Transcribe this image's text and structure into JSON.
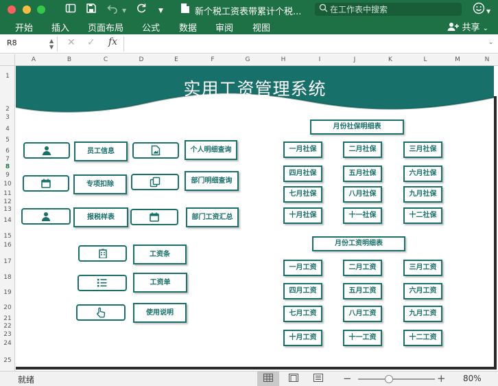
{
  "window": {
    "title": "新个税工资表带累计个税...",
    "search_placeholder": "在工作表中搜索"
  },
  "menu": {
    "items": [
      "开始",
      "插入",
      "页面布局",
      "公式",
      "数据",
      "审阅",
      "视图"
    ],
    "share_label": "共享"
  },
  "formula_bar": {
    "cell_ref": "R8",
    "fx_label": "fx",
    "formula_value": ""
  },
  "grid": {
    "columns": [
      "A",
      "B",
      "C",
      "D",
      "E",
      "F",
      "G",
      "H",
      "I",
      "J",
      "K",
      "L",
      "M",
      "N"
    ],
    "rows": [
      "1",
      "2",
      "3",
      "4",
      "5",
      "6",
      "7",
      "8",
      "9",
      "10",
      "11",
      "12",
      "13",
      "14",
      "15",
      "16",
      "17",
      "18",
      "19",
      "20",
      "21",
      "22",
      "23",
      "24",
      "25"
    ],
    "active_row": "8"
  },
  "sheet": {
    "title": "实用工资管理系统",
    "banner_color": "#17706a",
    "left_menu": [
      {
        "icon": "user-icon",
        "label": "员工信息"
      },
      {
        "icon": "calendar-icon",
        "label": "专项扣除"
      },
      {
        "icon": "user-icon",
        "label": "报税样表"
      }
    ],
    "right_menu": [
      {
        "icon": "document-icon",
        "label": "个人明细查询"
      },
      {
        "icon": "copy-icon",
        "label": "部门明细查询"
      },
      {
        "icon": "calendar-icon",
        "label": "部门工资汇总"
      }
    ],
    "bottom_menu": [
      {
        "icon": "building-icon",
        "label": "工资条"
      },
      {
        "icon": "list-icon",
        "label": "工资单"
      },
      {
        "icon": "hand-pointer-icon",
        "label": "使用说明"
      }
    ],
    "social_section": {
      "title": "月份社保明细表",
      "items": [
        "一月社保",
        "二月社保",
        "三月社保",
        "四月社保",
        "五月社保",
        "六月社保",
        "七月社保",
        "八月社保",
        "九月社保",
        "十月社保",
        "十一社保",
        "十二社保"
      ]
    },
    "salary_section": {
      "title": "月份工资明细表",
      "items": [
        "一月工资",
        "二月工资",
        "三月工资",
        "四月工资",
        "五月工资",
        "六月工资",
        "七月工资",
        "八月工资",
        "九月工资",
        "十月工资",
        "十一工资",
        "十二工资"
      ]
    }
  },
  "status_bar": {
    "status": "就绪",
    "zoom_level": "80%",
    "zoom_fraction": 0.4
  }
}
